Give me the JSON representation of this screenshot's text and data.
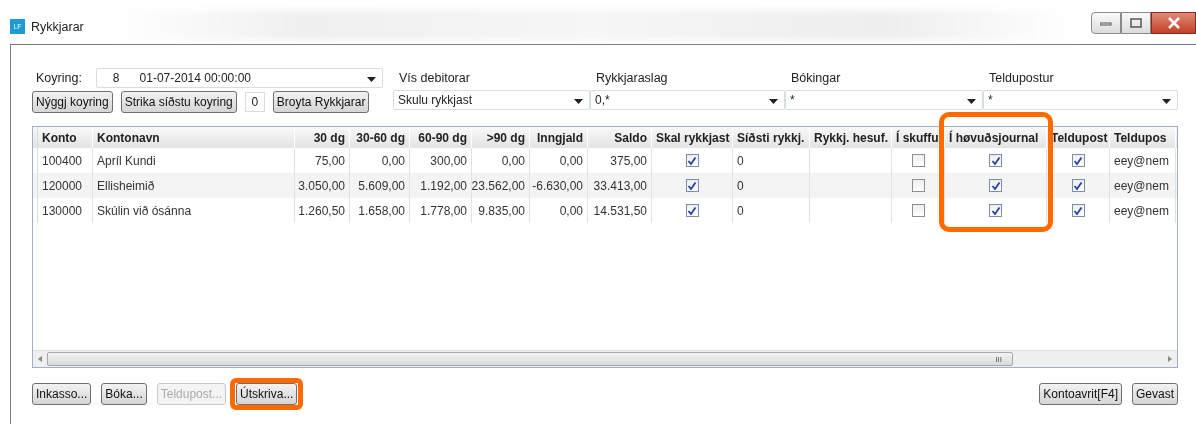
{
  "window": {
    "app_badge": "LF",
    "title": "Rykkjarar"
  },
  "koyring": {
    "label": "Koyring:",
    "number": "8",
    "value": "01-07-2014 00:00:00"
  },
  "filters": [
    {
      "label": "Vís debitorar",
      "value": "Skulu rykkjast"
    },
    {
      "label": "Rykkjaraslag",
      "value": "0,*"
    },
    {
      "label": "Bókingar",
      "value": "*"
    },
    {
      "label": "Teldupostur",
      "value": "*"
    }
  ],
  "toolbar": [
    {
      "kind": "button",
      "label": "Nýggj koyring"
    },
    {
      "kind": "button",
      "label": "Strika síðstu koyring"
    },
    {
      "kind": "field",
      "value": "0"
    },
    {
      "kind": "button",
      "label": "Broyta Rykkjarar"
    }
  ],
  "table": {
    "columns": [
      {
        "label": "Konto",
        "kind": "text",
        "highlighted": false
      },
      {
        "label": "Kontonavn",
        "kind": "text",
        "highlighted": false
      },
      {
        "label": "30 dg",
        "kind": "number",
        "highlighted": false
      },
      {
        "label": "30-60 dg",
        "kind": "number",
        "highlighted": false
      },
      {
        "label": "60-90 dg",
        "kind": "number",
        "highlighted": false
      },
      {
        "label": ">90 dg",
        "kind": "number",
        "highlighted": false
      },
      {
        "label": "Inngjald",
        "kind": "number",
        "highlighted": false
      },
      {
        "label": "Saldo",
        "kind": "number",
        "highlighted": false
      },
      {
        "label": "Skal rykkjast",
        "kind": "check",
        "highlighted": false
      },
      {
        "label": "Síðsti rykkj.",
        "kind": "text",
        "highlighted": false
      },
      {
        "label": "Rykkj. hesuf.",
        "kind": "text",
        "highlighted": false
      },
      {
        "label": "Í skuffu",
        "kind": "check",
        "highlighted": false
      },
      {
        "label": "Í høvuðsjournal",
        "kind": "check",
        "highlighted": true
      },
      {
        "label": "Teldupost",
        "kind": "check",
        "highlighted": false
      },
      {
        "label": "Teldupos",
        "kind": "text",
        "highlighted": false
      }
    ],
    "rows": [
      {
        "cells": [
          "100400",
          "Apríl Kundi",
          "75,00",
          "0,00",
          "300,00",
          "0,00",
          "0,00",
          "375,00",
          true,
          "0",
          null,
          false,
          true,
          true,
          "eey@nem"
        ]
      },
      {
        "cells": [
          "120000",
          "Ellisheimið",
          "3.050,00",
          "5.609,00",
          "1.192,00",
          "23.562,00",
          "-6.630,00",
          "33.413,00",
          true,
          "0",
          null,
          false,
          true,
          true,
          "eey@nem"
        ]
      },
      {
        "cells": [
          "130000",
          "Skúlin við ósánna",
          "1.260,50",
          "1.658,00",
          "1.778,00",
          "9.835,00",
          "0,00",
          "14.531,50",
          true,
          "0",
          null,
          false,
          true,
          true,
          "eey@nem"
        ]
      }
    ]
  },
  "scrollbar_grip": "III",
  "actions_left": [
    {
      "label": "Inkasso...",
      "disabled": false,
      "highlighted": false
    },
    {
      "label": "Bóka...",
      "disabled": false,
      "highlighted": false
    },
    {
      "label": "Teldupost...",
      "disabled": true,
      "highlighted": false
    },
    {
      "label": "Útskriva...",
      "disabled": false,
      "highlighted": true
    }
  ],
  "actions_right": [
    {
      "label": "Kontoavrit[F4]",
      "disabled": false,
      "highlighted": false
    },
    {
      "label": "Gevast",
      "disabled": false,
      "highlighted": false
    }
  ]
}
